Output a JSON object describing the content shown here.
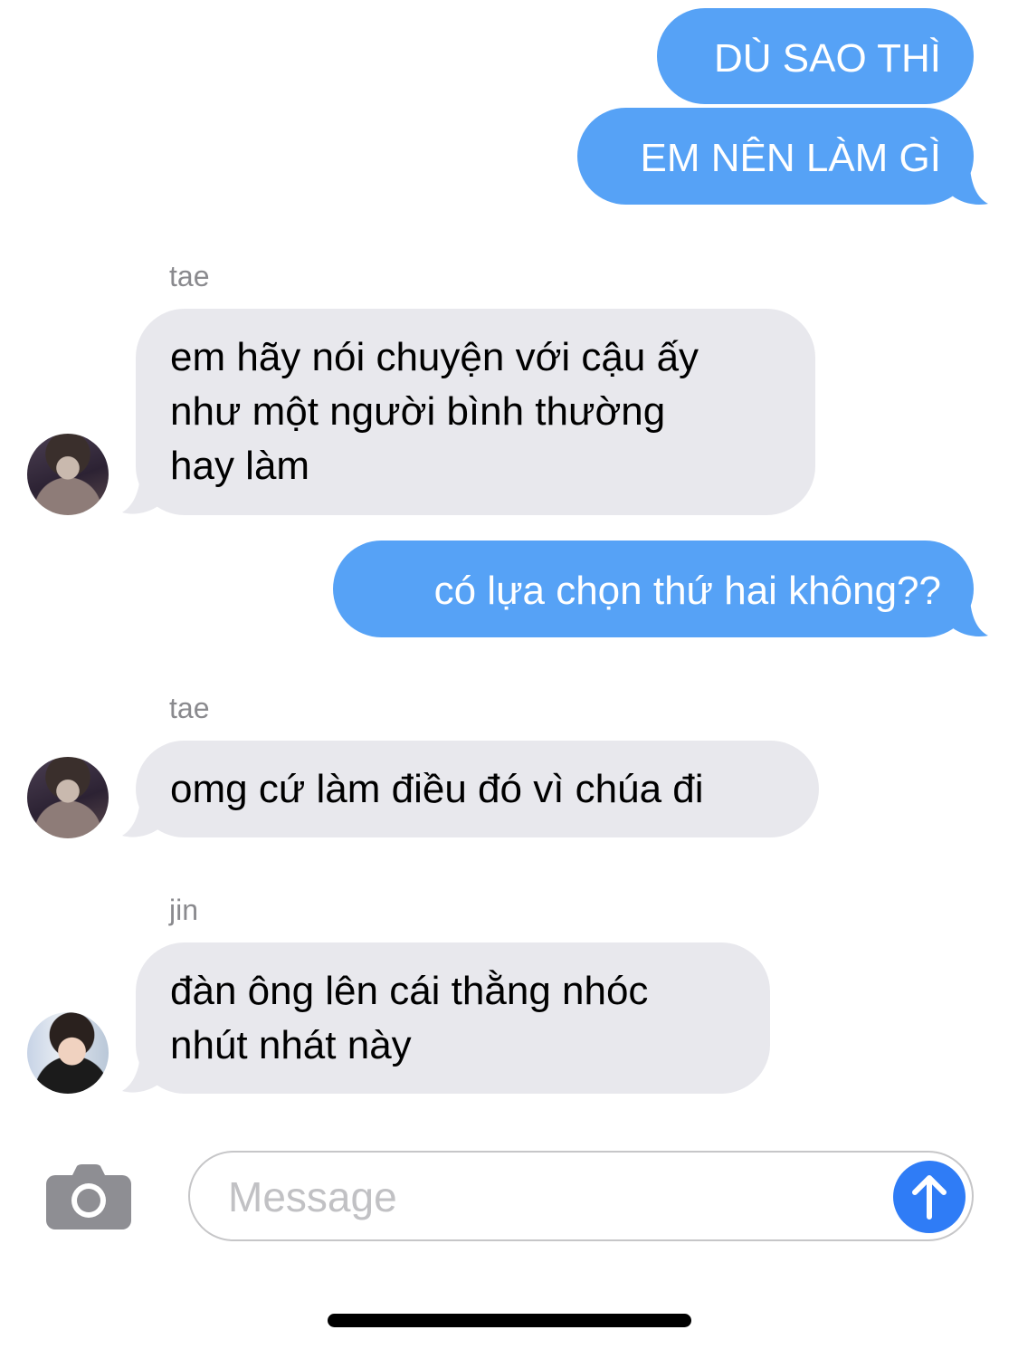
{
  "conversation": {
    "messages": [
      {
        "direction": "outgoing",
        "text": "DÙ SAO THÌ"
      },
      {
        "direction": "outgoing",
        "text": "EM NÊN LÀM GÌ"
      },
      {
        "direction": "incoming",
        "sender": "tae",
        "lines": [
          "em hãy nói chuyện với cậu ấy",
          "như một người bình thường",
          "hay làm"
        ]
      },
      {
        "direction": "outgoing",
        "text": "có lựa chọn thứ hai không??"
      },
      {
        "direction": "incoming",
        "sender": "tae",
        "lines": [
          "omg cứ làm điều đó vì chúa đi"
        ]
      },
      {
        "direction": "incoming",
        "sender": "jin",
        "lines": [
          "đàn ông lên cái thằng nhóc",
          "nhút nhát này"
        ]
      }
    ]
  },
  "composer": {
    "placeholder": "Message",
    "camera_icon": "camera-icon",
    "send_icon": "arrow-up-icon"
  },
  "colors": {
    "outgoing_bubble": "#56a2f6",
    "incoming_bubble": "#e8e8ed",
    "send_button": "#2f7cf6",
    "sender_name": "#8a8a8e"
  }
}
